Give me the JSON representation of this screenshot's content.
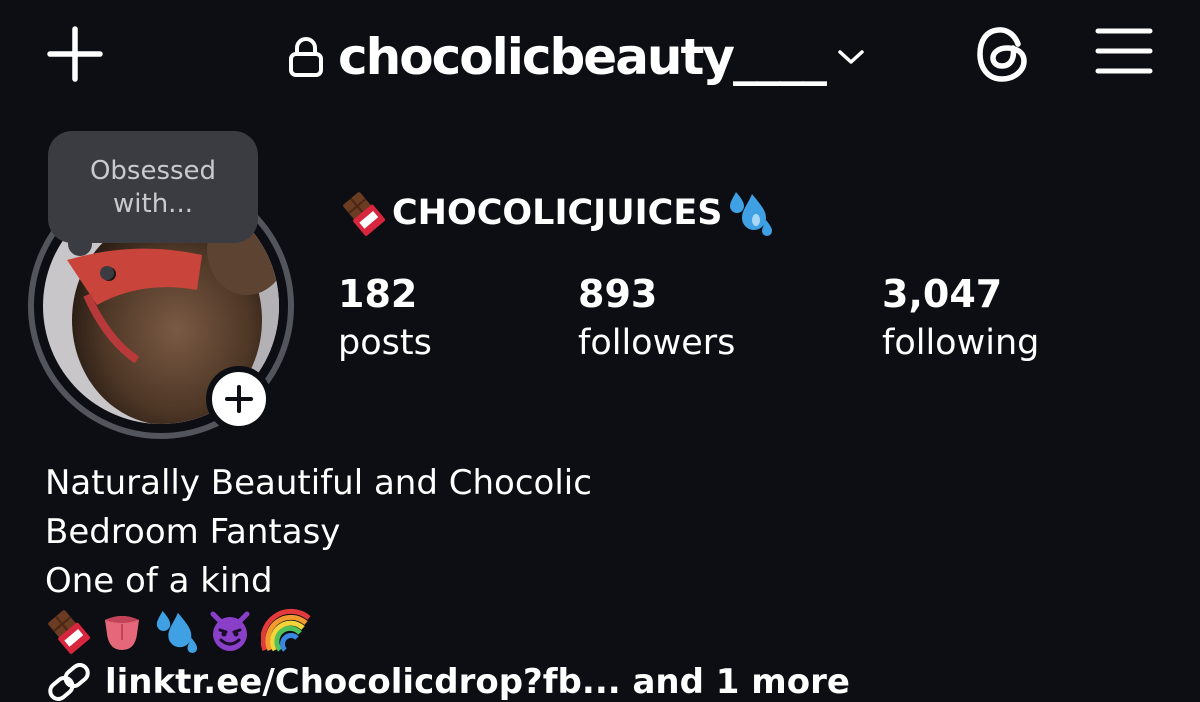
{
  "header": {
    "new_post_icon": "plus-icon",
    "lock_icon": "lock-icon",
    "username": "chocolicbeauty____",
    "account_switch_icon": "chevron-down-icon",
    "threads_icon": "threads-icon",
    "menu_icon": "hamburger-menu-icon"
  },
  "profile": {
    "note": "Obsessed with...",
    "display_name": "CHOCOLICJUICES",
    "display_name_emoji_left": "chocolate-bar-icon",
    "display_name_emoji_right": "sweat-droplets-icon",
    "add_story_icon": "plus-icon"
  },
  "stats": {
    "posts_count": "182",
    "posts_label": "posts",
    "followers_count": "893",
    "followers_label": "followers",
    "following_count": "3,047",
    "following_label": "following"
  },
  "bio": {
    "line1": "Naturally Beautiful and Chocolic",
    "line2": "Bedroom Fantasy",
    "line3": "One of a kind",
    "emojis": [
      "chocolate-bar-icon",
      "tongue-icon",
      "sweat-droplets-icon",
      "smiling-devil-icon",
      "rainbow-icon"
    ]
  },
  "link": {
    "icon": "link-icon",
    "text": "linktr.ee/Chocolicdrop?fb... and 1 more"
  },
  "colors": {
    "background": "#0c0e13",
    "text": "#ffffff",
    "note_bubble": "#3a3c42",
    "ring": "#52555c"
  }
}
